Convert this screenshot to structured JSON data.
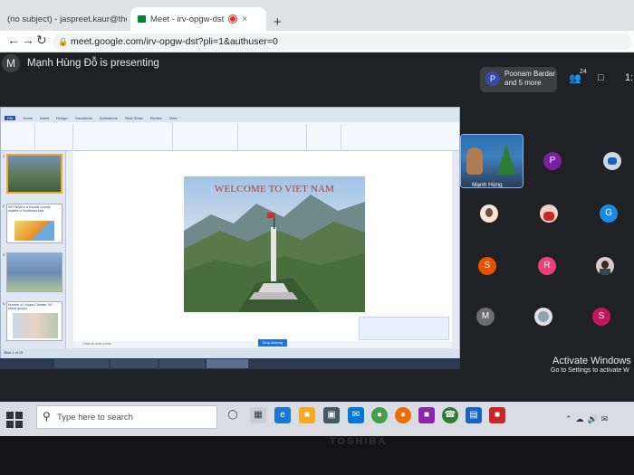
{
  "browser": {
    "tabs": [
      {
        "title": "(no subject) - jaspreet.kaur@the",
        "close": "×"
      },
      {
        "title": "Meet - irv-opgw-dst",
        "close": "×"
      }
    ],
    "new_tab": "+",
    "url": "meet.google.com/irv-opgw-dst?pli=1&authuser=0",
    "back_icon": "←",
    "forward_icon": "→",
    "reload_icon": "↻"
  },
  "meet": {
    "avatar_letter": "M",
    "presenting_text": "Mạnh Hùng Đỗ is presenting",
    "people_chip": {
      "initial": "P",
      "line1": "Poonam Bardar",
      "line2": "and 5 more"
    },
    "participant_count": "24",
    "clock_fragment": "1:",
    "self_tile_name": "Mạnh Hùng"
  },
  "presentation": {
    "ribbon_tabs": [
      "File",
      "Home",
      "Insert",
      "Design",
      "Transitions",
      "Animations",
      "Slide Show",
      "Review",
      "View"
    ],
    "slide_title": "WELCOME TO VIET NAM",
    "thumbnails": [
      {
        "num": "1",
        "title": ""
      },
      {
        "num": "2",
        "title": "VIETNAM is a tropical country located in Southeast Asia"
      },
      {
        "num": "3",
        "title": ""
      },
      {
        "num": "4",
        "title": "Number of Unique Chinese: 54 ethnic groups..."
      }
    ],
    "notes_placeholder": "Click to add notes",
    "status_text": "Slide 1 of 15",
    "slide_button": "Stop sharing"
  },
  "participants": [
    {
      "initial": "P",
      "color": "#7b1fa2"
    },
    {
      "initial": "",
      "color": "#cfd8dc"
    },
    {
      "initial": "",
      "color": "#f5e6d8"
    },
    {
      "initial": "",
      "color": "#f3d1c8"
    },
    {
      "initial": "G",
      "color": "#1e88e5"
    },
    {
      "initial": "S",
      "color": "#e65100"
    },
    {
      "initial": "R",
      "color": "#ec407a"
    },
    {
      "initial": "",
      "color": "#d7ccc8"
    },
    {
      "initial": "M",
      "color": "#6d6d6d"
    },
    {
      "initial": "",
      "color": "#e0e0e0"
    },
    {
      "initial": "S",
      "color": "#c2185b"
    }
  ],
  "watermark": {
    "title": "Activate Windows",
    "subtitle": "Go to Settings to activate W"
  },
  "taskbar": {
    "search_placeholder": "Type here to search",
    "brand": "TOSHIBA"
  }
}
